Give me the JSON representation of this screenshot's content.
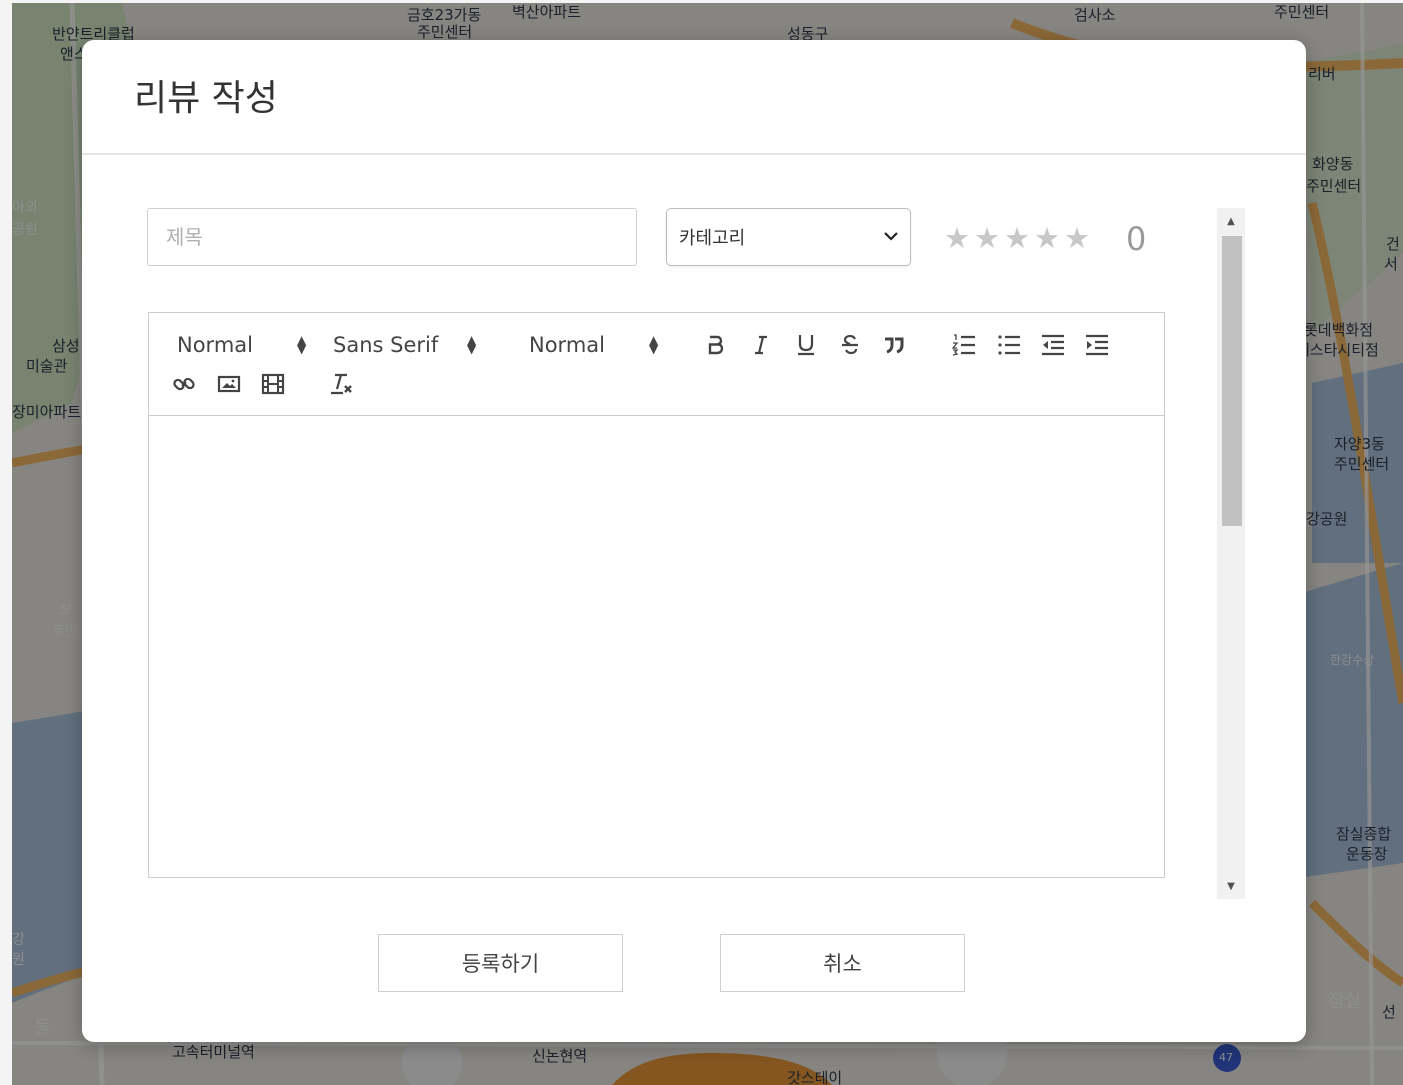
{
  "map": {
    "labels": [
      "반얀트리클럽",
      "앤스",
      "금호23가동",
      "주민센터",
      "벽산아파트",
      "성동구",
      "검사소",
      "주민센터",
      "리버",
      "화양동",
      "주민센터",
      "건",
      "서",
      "아외",
      "공원",
      "삼성",
      "미술관",
      "장미아파트",
      "롯데백화점",
      "에스타시티점",
      "자양3동",
      "주민센터",
      "강공원",
      "보",
      "주민",
      "한강수상",
      "잠실종합",
      "운동장",
      "강",
      "원",
      "잠실",
      "선",
      "동",
      "고속터미널역",
      "신논현역",
      "갓스테이",
      "47"
    ]
  },
  "modal": {
    "title": "리뷰 작성",
    "title_placeholder": "제목",
    "category": {
      "selected": "카테고리"
    },
    "rating": {
      "max_stars": 5,
      "value": 0,
      "display": "0"
    },
    "toolbar": {
      "header_picker": "Normal",
      "font_picker": "Sans Serif",
      "size_picker": "Normal",
      "icons": [
        "bold-icon",
        "italic-icon",
        "underline-icon",
        "strike-icon",
        "blockquote-icon",
        "ordered-list-icon",
        "bullet-list-icon",
        "outdent-icon",
        "indent-icon",
        "link-icon",
        "image-icon",
        "video-icon",
        "clear-format-icon"
      ]
    },
    "buttons": {
      "submit": "등록하기",
      "cancel": "취소"
    }
  },
  "colors": {
    "overlay": "#000000",
    "modal_bg": "#ffffff",
    "star_inactive": "#c8c8c8",
    "map_road": "#e8a04a",
    "map_river": "#8fa9c6"
  }
}
